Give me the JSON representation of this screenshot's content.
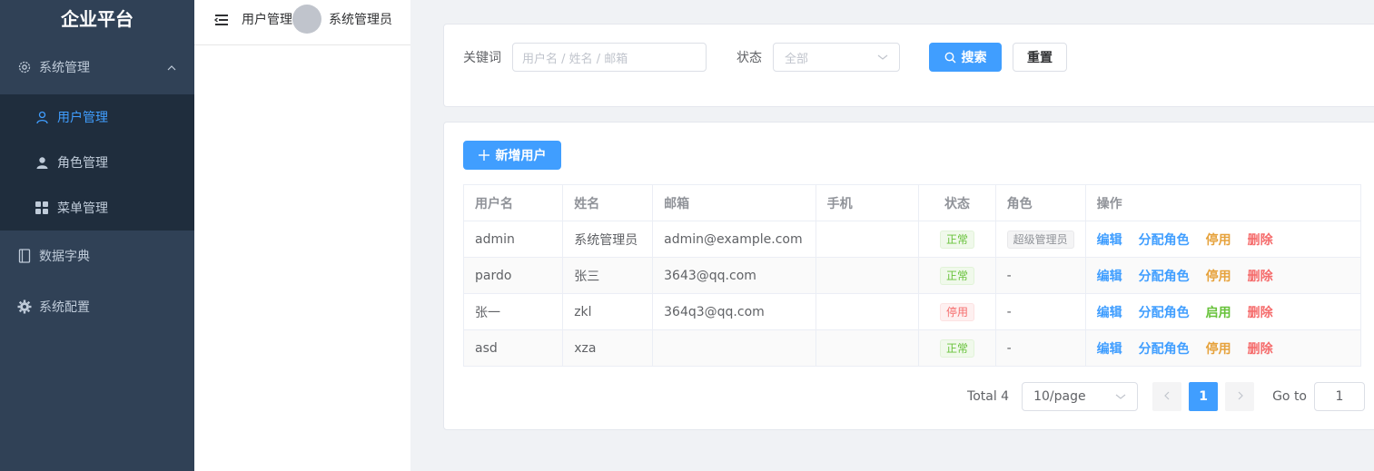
{
  "app": {
    "title": "企业平台"
  },
  "sidebar": {
    "groups": [
      {
        "label": "系统管理",
        "icon": "gear-icon",
        "expanded": true,
        "items": [
          {
            "label": "用户管理",
            "icon": "user-outline-icon",
            "active": true
          },
          {
            "label": "角色管理",
            "icon": "user-filled-icon",
            "active": false
          },
          {
            "label": "菜单管理",
            "icon": "grid-icon",
            "active": false
          }
        ]
      },
      {
        "label": "数据字典",
        "icon": "notebook-icon"
      },
      {
        "label": "系统配置",
        "icon": "settings-icon"
      }
    ]
  },
  "header": {
    "breadcrumb": "用户管理",
    "username": "系统管理员",
    "menu_icon": "hamburger-icon"
  },
  "search": {
    "keyword_label": "关键词",
    "keyword_placeholder": "用户名 / 姓名 / 邮箱",
    "status_label": "状态",
    "status_value": "全部",
    "search_button": "搜索",
    "reset_button": "重置"
  },
  "list": {
    "add_button": "新增用户",
    "columns": [
      "用户名",
      "姓名",
      "邮箱",
      "手机",
      "状态",
      "角色",
      "操作"
    ],
    "rows": [
      {
        "username": "admin",
        "name": "系统管理员",
        "email": "admin@example.com",
        "phone": "",
        "status": "正常",
        "status_type": "success",
        "role": "超级管理员",
        "ops": [
          "编辑",
          "分配角色",
          "停用",
          "删除"
        ]
      },
      {
        "username": "pardo",
        "name": "张三",
        "email": "3643@qq.com",
        "phone": "",
        "status": "正常",
        "status_type": "success",
        "role": "-",
        "ops": [
          "编辑",
          "分配角色",
          "停用",
          "删除"
        ]
      },
      {
        "username": "张一",
        "name": "zkl",
        "email": "364q3@qq.com",
        "phone": "",
        "status": "停用",
        "status_type": "danger",
        "role": "-",
        "ops": [
          "编辑",
          "分配角色",
          "启用",
          "删除"
        ]
      },
      {
        "username": "asd",
        "name": "xza",
        "email": "",
        "phone": "",
        "status": "正常",
        "status_type": "success",
        "role": "-",
        "ops": [
          "编辑",
          "分配角色",
          "停用",
          "删除"
        ]
      }
    ]
  },
  "pagination": {
    "total": "Total 4",
    "page_size": "10/page",
    "current_page": "1",
    "goto_label": "Go to",
    "goto_value": "1"
  },
  "colors": {
    "sidebar_bg": "#304156",
    "submenu_bg": "#1f2d3d",
    "primary": "#409eff",
    "success": "#67c23a",
    "warning": "#e6a23c",
    "danger": "#f56c6c"
  }
}
